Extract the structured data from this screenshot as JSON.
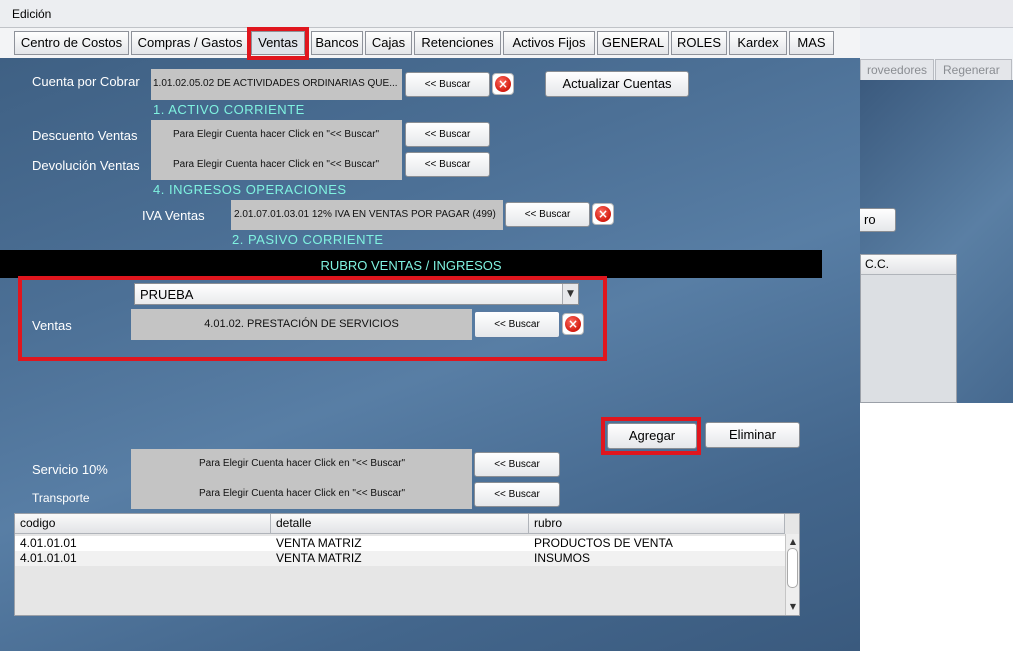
{
  "window": {
    "menu_item": "Edición"
  },
  "tabs": [
    {
      "label": "Centro de Costos"
    },
    {
      "label": "Compras / Gastos"
    },
    {
      "label": "Ventas"
    },
    {
      "label": "Bancos"
    },
    {
      "label": "Cajas"
    },
    {
      "label": "Retenciones"
    },
    {
      "label": "Activos Fijos"
    },
    {
      "label": "GENERAL"
    },
    {
      "label": "ROLES"
    },
    {
      "label": "Kardex"
    },
    {
      "label": "MAS"
    }
  ],
  "background_window": {
    "tabs": [
      "roveedores",
      "Regenerar"
    ],
    "button_fragment": "ro",
    "header_fragment": "C.C."
  },
  "accounts": {
    "cuenta_por_cobrar": {
      "label": "Cuenta por Cobrar",
      "value": "1.01.02.05.02  DE ACTIVIDADES ORDINARIAS QUE...",
      "category": "1. ACTIVO CORRIENTE"
    },
    "descuento_ventas": {
      "label": "Descuento Ventas",
      "value": "Para Elegir Cuenta hacer Click en   \"<< Buscar\""
    },
    "devolucion_ventas": {
      "label": "Devolución Ventas",
      "value": "Para Elegir Cuenta hacer Click en   \"<< Buscar\"",
      "category": "4. INGRESOS OPERACIONES"
    },
    "iva_ventas": {
      "label": "IVA Ventas",
      "value": "2.01.07.01.03.01 12% IVA EN VENTAS POR PAGAR (499)",
      "category": "2. PASIVO CORRIENTE"
    }
  },
  "buttons": {
    "buscar": "<< Buscar",
    "actualizar": "Actualizar  Cuentas",
    "agregar": "Agregar",
    "eliminar": "Eliminar",
    "remove_glyph": "×"
  },
  "rubro": {
    "title": "RUBRO VENTAS / INGRESOS",
    "select_value": "PRUEBA",
    "ventas_label": "Ventas",
    "ventas_value": "4.01.02. PRESTACIÓN DE SERVICIOS"
  },
  "extras": {
    "servicio": {
      "label": "Servicio 10%",
      "value": "Para Elegir Cuenta hacer Click en   \"<< Buscar\""
    },
    "transporte": {
      "label": "Transporte",
      "value": "Para Elegir Cuenta hacer Click en   \"<< Buscar\""
    }
  },
  "table": {
    "columns": [
      "codigo",
      "detalle",
      "rubro"
    ],
    "rows": [
      {
        "codigo": "4.01.01.01",
        "detalle": "VENTA MATRIZ",
        "rubro": "PRODUCTOS DE VENTA"
      },
      {
        "codigo": "4.01.01.01",
        "detalle": "VENTA MATRIZ",
        "rubro": "INSUMOS"
      }
    ]
  },
  "colors": {
    "highlight": "#e0161e",
    "category_text": "#7ff2e0",
    "field_bg": "#c4c4c4",
    "panel_bg": "#4c7096"
  }
}
